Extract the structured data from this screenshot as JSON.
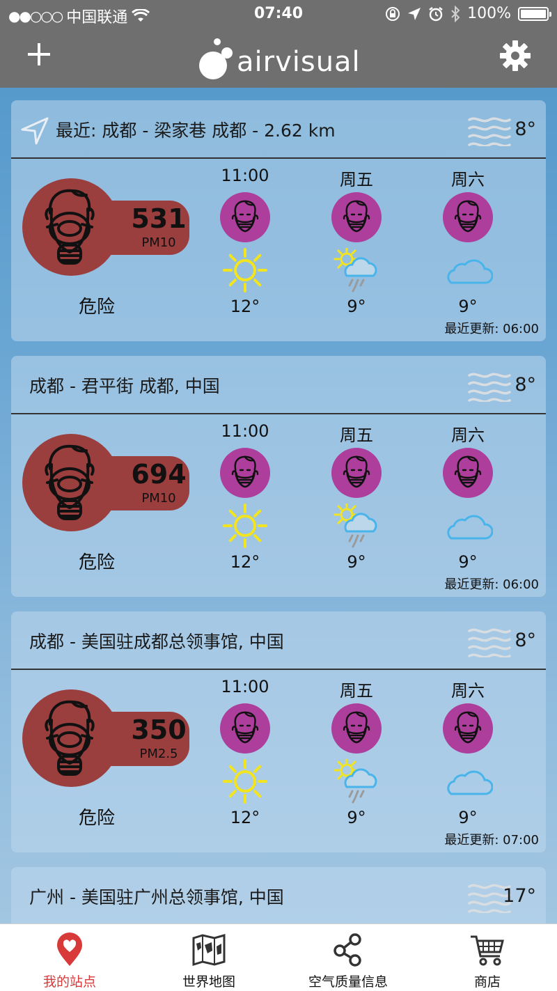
{
  "status_bar": {
    "signal": "●●○○○",
    "carrier": "中国联通",
    "time": "07:40",
    "battery": "100%"
  },
  "header": {
    "logo_text": "airvisual",
    "brand_color": "#ffffff",
    "bar_color": "#6f6f6f"
  },
  "stations": [
    {
      "title": "最近: 成都 - 梁家巷 成都 - 2.62 km",
      "is_nearest": true,
      "temp": "8°",
      "aqi": "531",
      "pollutant": "PM10",
      "status": "危险",
      "aqi_color": "#9b3e3e",
      "forecast": [
        {
          "label": "11:00",
          "weather": "sunny",
          "temp": "12°"
        },
        {
          "label": "周五",
          "weather": "sun-rain",
          "temp": "9°"
        },
        {
          "label": "周六",
          "weather": "cloudy",
          "temp": "9°"
        }
      ],
      "updated": "最近更新: 06:00"
    },
    {
      "title": "成都 - 君平街 成都, 中国",
      "is_nearest": false,
      "temp": "8°",
      "aqi": "694",
      "pollutant": "PM10",
      "status": "危险",
      "aqi_color": "#9b3e3e",
      "forecast": [
        {
          "label": "11:00",
          "weather": "sunny",
          "temp": "12°"
        },
        {
          "label": "周五",
          "weather": "sun-rain",
          "temp": "9°"
        },
        {
          "label": "周六",
          "weather": "cloudy",
          "temp": "9°"
        }
      ],
      "updated": "最近更新: 06:00"
    },
    {
      "title": "成都 - 美国驻成都总领事馆, 中国",
      "is_nearest": false,
      "temp": "8°",
      "aqi": "350",
      "pollutant": "PM2.5",
      "status": "危险",
      "aqi_color": "#9b3e3e",
      "forecast": [
        {
          "label": "11:00",
          "weather": "sunny",
          "temp": "12°"
        },
        {
          "label": "周五",
          "weather": "sun-rain",
          "temp": "9°"
        },
        {
          "label": "周六",
          "weather": "cloudy",
          "temp": "9°"
        }
      ],
      "updated": "最近更新: 07:00"
    },
    {
      "title": "广州 - 美国驻广州总领事馆, 中国",
      "is_nearest": false,
      "temp": "17°"
    }
  ],
  "tabs": [
    {
      "label": "我的站点",
      "icon": "heart-pin-icon",
      "active": true
    },
    {
      "label": "世界地图",
      "icon": "world-map-icon",
      "active": false
    },
    {
      "label": "空气质量信息",
      "icon": "share-nodes-icon",
      "active": false
    },
    {
      "label": "商店",
      "icon": "cart-icon",
      "active": false
    }
  ],
  "colors": {
    "danger": "#9b3e3e",
    "forecast_face": "#ad3e9c",
    "active_tab": "#d83a3a",
    "sun": "#f2e41f",
    "cloud": "#48b4ea"
  }
}
